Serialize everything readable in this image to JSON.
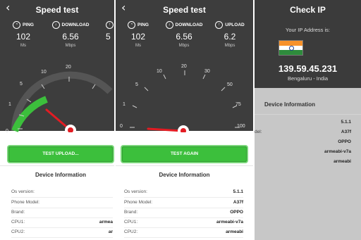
{
  "screen1": {
    "title": "Speed test",
    "ping": {
      "label": "PING",
      "value": "102",
      "unit": "Ms"
    },
    "download": {
      "label": "DOWNLOAD",
      "value": "6.56",
      "unit": "Mbps"
    },
    "upload": {
      "value": "5"
    },
    "ticks": [
      "0",
      "1",
      "5",
      "10",
      "20"
    ],
    "button": "TEST UPLOAD...",
    "device_title": "Device Information",
    "rows": [
      {
        "key": "Os version:",
        "value": ""
      },
      {
        "key": "Phone Model:",
        "value": ""
      },
      {
        "key": "Brand:",
        "value": ""
      },
      {
        "key": "CPU1:",
        "value": "armea"
      },
      {
        "key": "CPU2:",
        "value": "ar"
      }
    ]
  },
  "screen2": {
    "title": "Speed test",
    "ping": {
      "label": "PING",
      "value": "102",
      "unit": "Ms"
    },
    "download": {
      "label": "DOWNLOAD",
      "value": "6.56",
      "unit": "Mbps"
    },
    "upload": {
      "label": "UPLOAD",
      "value": "6.2",
      "unit": "Mbps"
    },
    "ticks": [
      "0",
      "1",
      "5",
      "10",
      "20",
      "30",
      "50",
      "75",
      "100"
    ],
    "button": "TEST AGAIN",
    "device_title": "Device Information",
    "rows": [
      {
        "key": "Os version:",
        "value": "5.1.1"
      },
      {
        "key": "Phone Model:",
        "value": "A37f"
      },
      {
        "key": "Brand:",
        "value": "OPPO"
      },
      {
        "key": "CPU1:",
        "value": "armeabi-v7a"
      },
      {
        "key": "CPU2:",
        "value": "armeabi"
      }
    ]
  },
  "screen3": {
    "title": "Check IP",
    "ip_label": "Your IP Address is:",
    "ip": "139.59.45.231",
    "location": "Bengaluru - India",
    "device_title": "Device Information",
    "model_key": "del:",
    "values": [
      "5.1.1",
      "A37f",
      "OPPO",
      "armeabi-v7a",
      "armeabi"
    ]
  },
  "colors": {
    "dark": "#3d3d3d",
    "accent": "#3cbf3c",
    "needle": "#e31c23"
  }
}
